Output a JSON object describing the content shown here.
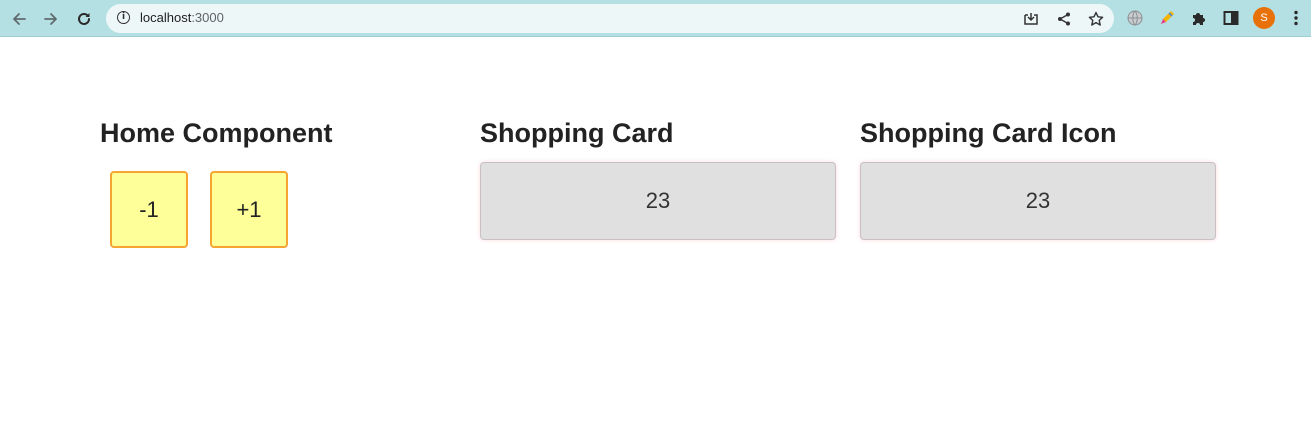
{
  "browser": {
    "url_host": "localhost",
    "url_port": ":3000",
    "profile_initial": "S",
    "accent_color": "#b5e0e3",
    "avatar_color": "#e8710a",
    "icons": [
      "back-arrow-icon",
      "forward-arrow-icon",
      "reload-icon",
      "info-icon",
      "install-icon",
      "share-icon",
      "star-icon",
      "globe-extension-icon",
      "pen-extension-icon",
      "puzzle-extensions-icon",
      "side-panel-icon",
      "kebab-menu-icon"
    ]
  },
  "home": {
    "title": "Home Component",
    "decrement_label": "-1",
    "increment_label": "+1",
    "button_color": "#ffff99",
    "button_border_color": "#f6a531"
  },
  "shopping_card": {
    "title": "Shopping Card",
    "count": "23"
  },
  "shopping_card_icon": {
    "title": "Shopping Card Icon",
    "count": "23"
  }
}
